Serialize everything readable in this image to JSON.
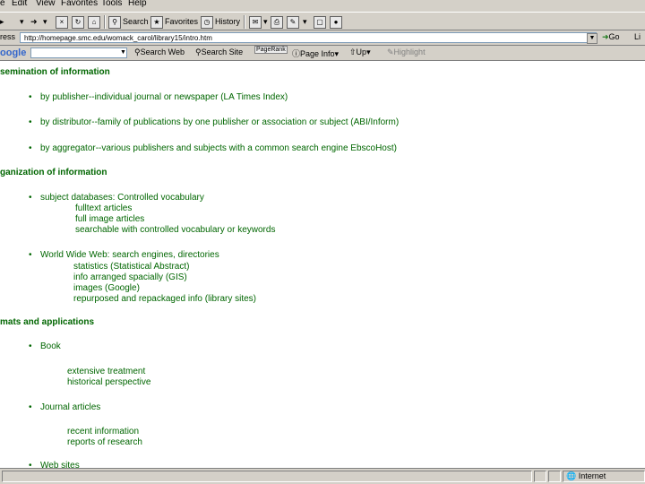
{
  "menu": [
    "e",
    "Edit",
    "View",
    "Favorites",
    "Tools",
    "Help"
  ],
  "toolbar": {
    "back": "",
    "search": "Search",
    "favorites": "Favorites",
    "history": "History"
  },
  "address": {
    "label": "ress",
    "url": "http://homepage.smc.edu/womack_carol/library15/intro.htm",
    "go": "Go",
    "links": "Li"
  },
  "google": {
    "logo": "oogle",
    "search_web": "Search Web",
    "search_site": "Search Site",
    "pagerank": "PageRank",
    "page_info": "Page Info",
    "up": "Up",
    "highlight": "Highlight"
  },
  "content": {
    "sections": [
      {
        "heading": "semination of information",
        "items": [
          {
            "text": "by publisher--individual journal or newspaper (LA Times Index)",
            "subs": []
          },
          {
            "text": "by distributor--family of publications by one publisher or association or subject (ABI/Inform)",
            "subs": []
          },
          {
            "text": "by aggregator--various publishers and subjects with a common search engine EbscoHost)",
            "subs": []
          }
        ]
      },
      {
        "heading": "ganization of information",
        "items": [
          {
            "text": "subject databases:  Controlled vocabulary",
            "subs": [
              "fulltext articles",
              "full image articles",
              "searchable with controlled vocabulary or keywords"
            ]
          },
          {
            "text": "World Wide Web:  search engines, directories",
            "subs": [
              "statistics (Statistical Abstract)",
              "info arranged spacially (GIS)",
              "images (Google)",
              "repurposed and repackaged info (library sites)"
            ]
          }
        ]
      },
      {
        "heading": "mats and applications",
        "items": [
          {
            "text": "Book",
            "subs": [
              "extensive treatment",
              "historical perspective"
            ]
          },
          {
            "text": "Journal articles",
            "subs": [
              "recent information",
              "reports of research"
            ]
          },
          {
            "text": "Web sites",
            "subs": []
          }
        ]
      }
    ]
  },
  "status": {
    "zone": "Internet"
  }
}
